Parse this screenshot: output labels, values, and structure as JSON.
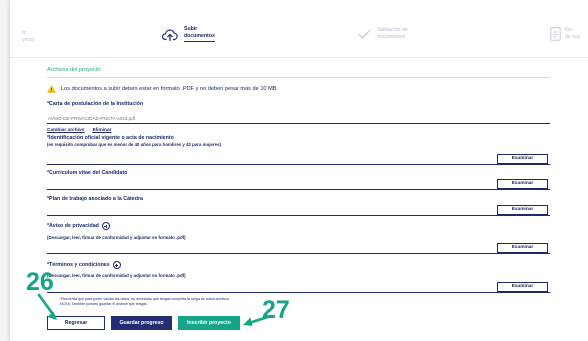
{
  "steps": {
    "left_partial": "In\nyecto",
    "subir": "Subir\ndocumentos",
    "validacion": "Validación de\ndocumentos",
    "fin": "Fin\nde reg"
  },
  "section_title": "Archivos del proyecto",
  "warning": "Los documentos a subir deben estar en formato .PDF y no deben pesar más de 10 MB.",
  "fields": {
    "carta": {
      "label": "*Carta de postulación de la Institución",
      "filename": "AVISO-DE-PRIVACIDAD-PNCTA-2016.pdf",
      "change_link": "Cambiar archivo",
      "delete_link": "Eliminar"
    },
    "identificacion": {
      "label": "*Identificación oficial vigente o acta de nacimiento",
      "hint": "(es requisito comprobar que es menor de 40 años para hombres y 42 para mujeres)",
      "browse": "Examinar"
    },
    "curriculum": {
      "label": "*Curriculum vitae del Candidato",
      "browse": "Examinar"
    },
    "plan": {
      "label": "*Plan de trabajo asociado a la Cátedra",
      "browse": "Examinar"
    },
    "aviso": {
      "label": "*Aviso de privacidad",
      "hint": "(Descargar, leer, firmar de conformidad y adjuntar en formato .pdf)",
      "browse": "Examinar"
    },
    "terminos": {
      "label": "*Términos y condiciones",
      "hint": "(Descargar, leer, firmar de conformidad y adjuntar en formato .pdf)",
      "browse": "Examinar"
    }
  },
  "notes": {
    "line1": "*Recuerda que para poder validar los datos, es necesario que tengas completa la carga de todos archivos.",
    "line2": "NOTA: También puedes guardar el avance que tengas."
  },
  "buttons": {
    "back": "Regresar",
    "save": "Guardar progreso",
    "submit": "Inscribir proyecto"
  },
  "annotations": {
    "left": "26",
    "right": "27",
    "color": "#17a58a"
  },
  "colors": {
    "navy": "#1f2a6b",
    "green": "#17a58a"
  },
  "icons": {
    "upload": "cloud-upload-icon",
    "check": "check-icon",
    "document": "document-icon",
    "warning": "warning-icon",
    "add": "plus-circle-icon"
  }
}
